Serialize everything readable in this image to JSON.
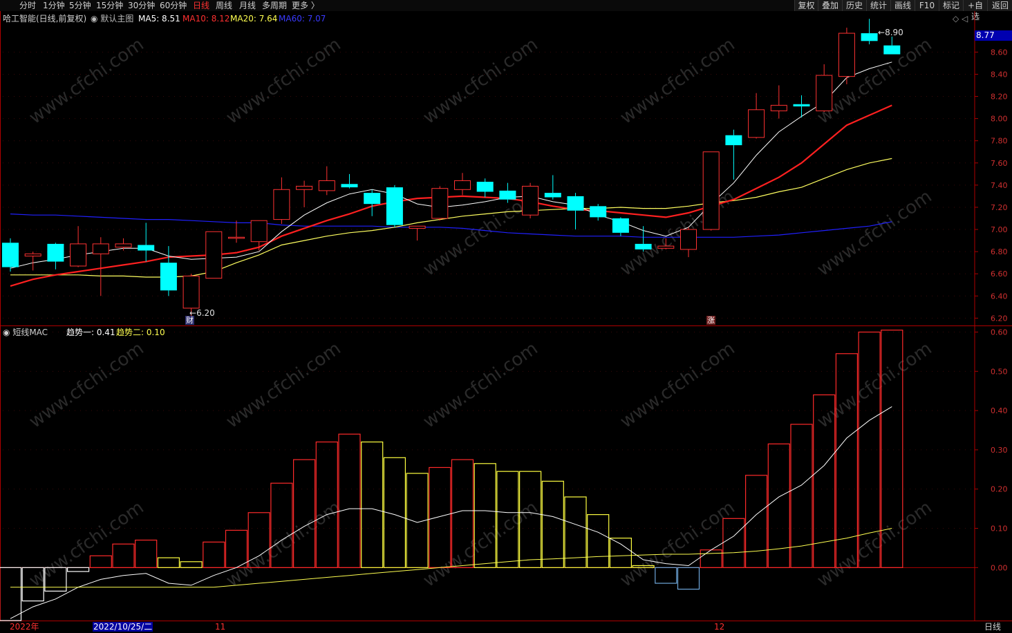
{
  "toolbar": {
    "periods": [
      "分时",
      "1分钟",
      "5分钟",
      "15分钟",
      "30分钟",
      "60分钟",
      "日线",
      "周线",
      "月线",
      "多周期",
      "更多 〉"
    ],
    "active_period": "日线",
    "right_buttons": [
      "复权",
      "叠加",
      "历史",
      "统计",
      "画线",
      "F10",
      "标记",
      "+自选",
      "返回"
    ]
  },
  "header": {
    "stock": "哈工智能(日线,前复权)",
    "template": "默认主图",
    "ma5": "MA5: 8.51",
    "ma10": "MA10: 8.12",
    "ma20": "MA20: 7.64",
    "ma60": "MA60: 7.07",
    "right_icons": "◇ ◁"
  },
  "indicator": {
    "name": "短线MAC",
    "trend1": "趋势一: 0.41",
    "trend2": "趋势二: 0.10"
  },
  "markers": {
    "high_label": "8.90",
    "low_label": "6.20",
    "badge_cai": "财",
    "badge_zhang": "涨",
    "current_price": "8.77"
  },
  "price_axis": [
    "8.60",
    "8.40",
    "8.20",
    "8.00",
    "7.80",
    "7.60",
    "7.40",
    "7.20",
    "7.00",
    "6.80",
    "6.60",
    "6.40",
    "6.20"
  ],
  "indicator_axis": [
    "0.60",
    "0.50",
    "0.40",
    "0.30",
    "0.20",
    "0.10",
    "0.00"
  ],
  "date_axis": {
    "year": "2022年",
    "cursor_date": "2022/10/25/二",
    "month11": "11",
    "month12": "12",
    "period_tag": "日线"
  },
  "colors": {
    "up": "#ff3232",
    "down": "#00ffff",
    "ma5": "#ffffff",
    "ma10": "#ff2020",
    "ma20": "#ffff60",
    "ma60": "#2020ff",
    "bar_red": "#ff2a2a",
    "bar_yellow": "#ffff40",
    "bar_blue": "#6fa8dc",
    "bar_white": "#ffffff",
    "axis": "#b00000",
    "watermark": "#2a2a2a"
  },
  "chart_data": [
    {
      "type": "candlestick",
      "title": "哈工智能(日线,前复权)",
      "ylim": [
        6.14,
        8.97
      ],
      "candles": [
        {
          "o": 6.88,
          "h": 6.92,
          "l": 6.62,
          "c": 6.66
        },
        {
          "o": 6.76,
          "h": 6.8,
          "l": 6.63,
          "c": 6.78
        },
        {
          "o": 6.87,
          "h": 6.88,
          "l": 6.64,
          "c": 6.71
        },
        {
          "o": 6.67,
          "h": 7.03,
          "l": 6.66,
          "c": 6.87
        },
        {
          "o": 6.78,
          "h": 6.93,
          "l": 6.4,
          "c": 6.87
        },
        {
          "o": 6.84,
          "h": 6.92,
          "l": 6.81,
          "c": 6.87
        },
        {
          "o": 6.86,
          "h": 7.06,
          "l": 6.71,
          "c": 6.81
        },
        {
          "o": 6.7,
          "h": 6.85,
          "l": 6.4,
          "c": 6.45
        },
        {
          "o": 6.29,
          "h": 6.6,
          "l": 6.2,
          "c": 6.58
        },
        {
          "o": 6.56,
          "h": 6.98,
          "l": 6.56,
          "c": 6.98
        },
        {
          "o": 6.92,
          "h": 7.08,
          "l": 6.88,
          "c": 6.93
        },
        {
          "o": 6.89,
          "h": 7.08,
          "l": 6.81,
          "c": 7.08
        },
        {
          "o": 7.09,
          "h": 7.47,
          "l": 7.05,
          "c": 7.36
        },
        {
          "o": 7.36,
          "h": 7.44,
          "l": 7.2,
          "c": 7.39
        },
        {
          "o": 7.35,
          "h": 7.57,
          "l": 7.31,
          "c": 7.44
        },
        {
          "o": 7.41,
          "h": 7.5,
          "l": 7.37,
          "c": 7.38
        },
        {
          "o": 7.33,
          "h": 7.36,
          "l": 7.12,
          "c": 7.23
        },
        {
          "o": 7.38,
          "h": 7.4,
          "l": 7.02,
          "c": 7.04
        },
        {
          "o": 7.01,
          "h": 7.03,
          "l": 6.9,
          "c": 7.03
        },
        {
          "o": 7.1,
          "h": 7.39,
          "l": 7.08,
          "c": 7.37
        },
        {
          "o": 7.36,
          "h": 7.51,
          "l": 7.31,
          "c": 7.44
        },
        {
          "o": 7.43,
          "h": 7.46,
          "l": 7.29,
          "c": 7.34
        },
        {
          "o": 7.35,
          "h": 7.42,
          "l": 7.24,
          "c": 7.27
        },
        {
          "o": 7.13,
          "h": 7.42,
          "l": 7.1,
          "c": 7.39
        },
        {
          "o": 7.33,
          "h": 7.49,
          "l": 7.27,
          "c": 7.29
        },
        {
          "o": 7.3,
          "h": 7.33,
          "l": 7.0,
          "c": 7.17
        },
        {
          "o": 7.21,
          "h": 7.23,
          "l": 7.08,
          "c": 7.11
        },
        {
          "o": 7.1,
          "h": 7.11,
          "l": 6.94,
          "c": 6.97
        },
        {
          "o": 6.87,
          "h": 7.03,
          "l": 6.8,
          "c": 6.82
        },
        {
          "o": 6.83,
          "h": 6.92,
          "l": 6.82,
          "c": 6.85
        },
        {
          "o": 6.82,
          "h": 7.02,
          "l": 6.75,
          "c": 7.0
        },
        {
          "o": 7.0,
          "h": 7.7,
          "l": 6.99,
          "c": 7.7
        },
        {
          "o": 7.85,
          "h": 7.9,
          "l": 7.45,
          "c": 7.76
        },
        {
          "o": 7.83,
          "h": 8.23,
          "l": 7.82,
          "c": 8.08
        },
        {
          "o": 8.07,
          "h": 8.3,
          "l": 8.0,
          "c": 8.12
        },
        {
          "o": 8.13,
          "h": 8.21,
          "l": 8.01,
          "c": 8.11
        },
        {
          "o": 8.07,
          "h": 8.49,
          "l": 8.06,
          "c": 8.39
        },
        {
          "o": 8.38,
          "h": 8.82,
          "l": 8.31,
          "c": 8.77
        },
        {
          "o": 8.77,
          "h": 8.9,
          "l": 8.67,
          "c": 8.7
        },
        {
          "o": 8.66,
          "h": 8.74,
          "l": 8.58,
          "c": 8.58
        }
      ],
      "ma5": [
        6.65,
        6.7,
        6.73,
        6.77,
        6.8,
        6.83,
        6.83,
        6.76,
        6.73,
        6.74,
        6.75,
        6.8,
        6.98,
        7.13,
        7.24,
        7.32,
        7.36,
        7.32,
        7.23,
        7.2,
        7.22,
        7.25,
        7.29,
        7.3,
        7.25,
        7.22,
        7.13,
        7.07,
        6.99,
        6.94,
        7.02,
        7.23,
        7.42,
        7.67,
        7.88,
        8.02,
        8.15,
        8.37,
        8.45,
        8.51
      ],
      "ma10": [
        6.49,
        6.55,
        6.59,
        6.62,
        6.65,
        6.68,
        6.71,
        6.75,
        6.76,
        6.77,
        6.79,
        6.84,
        6.94,
        7.01,
        7.08,
        7.14,
        7.21,
        7.25,
        7.28,
        7.29,
        7.3,
        7.29,
        7.28,
        7.25,
        7.21,
        7.18,
        7.17,
        7.15,
        7.13,
        7.11,
        7.15,
        7.21,
        7.27,
        7.37,
        7.47,
        7.6,
        7.77,
        7.94,
        8.03,
        8.12
      ],
      "ma20": [
        6.59,
        6.59,
        6.59,
        6.59,
        6.58,
        6.58,
        6.57,
        6.57,
        6.58,
        6.62,
        6.7,
        6.77,
        6.86,
        6.9,
        6.94,
        6.97,
        6.99,
        7.02,
        7.06,
        7.09,
        7.12,
        7.14,
        7.16,
        7.17,
        7.18,
        7.19,
        7.19,
        7.2,
        7.19,
        7.19,
        7.21,
        7.24,
        7.26,
        7.29,
        7.34,
        7.38,
        7.46,
        7.54,
        7.6,
        7.64
      ],
      "ma60": [
        7.14,
        7.13,
        7.13,
        7.12,
        7.11,
        7.1,
        7.09,
        7.09,
        7.08,
        7.07,
        7.06,
        7.06,
        7.04,
        7.03,
        7.03,
        7.03,
        7.03,
        7.02,
        7.02,
        7.02,
        7.01,
        6.99,
        6.97,
        6.96,
        6.95,
        6.94,
        6.94,
        6.94,
        6.93,
        6.93,
        6.93,
        6.93,
        6.93,
        6.94,
        6.95,
        6.97,
        6.99,
        7.01,
        7.03,
        7.07
      ]
    },
    {
      "type": "bar",
      "title": "短线MAC",
      "ylim": [
        -0.135,
        0.615
      ],
      "bars": [
        -0.135,
        -0.085,
        -0.06,
        -0.01,
        0.03,
        0.06,
        0.07,
        0.025,
        0.015,
        0.065,
        0.095,
        0.14,
        0.215,
        0.275,
        0.32,
        0.34,
        0.32,
        0.28,
        0.24,
        0.255,
        0.275,
        0.265,
        0.245,
        0.245,
        0.22,
        0.18,
        0.135,
        0.075,
        0.005,
        -0.04,
        -0.055,
        0.045,
        0.125,
        0.235,
        0.315,
        0.365,
        0.44,
        0.545,
        0.6,
        0.605
      ],
      "bar_colors": [
        "white",
        "white",
        "white",
        "white",
        "red",
        "red",
        "red",
        "yellow",
        "yellow",
        "red",
        "red",
        "red",
        "red",
        "red",
        "red",
        "red",
        "yellow",
        "yellow",
        "yellow",
        "red",
        "red",
        "yellow",
        "yellow",
        "yellow",
        "yellow",
        "yellow",
        "yellow",
        "yellow",
        "yellow",
        "blue",
        "blue",
        "red",
        "red",
        "red",
        "red",
        "red",
        "red",
        "red",
        "red",
        "red"
      ],
      "trend1": [
        -0.13,
        -0.1,
        -0.08,
        -0.05,
        -0.03,
        -0.02,
        -0.015,
        -0.04,
        -0.045,
        -0.02,
        0.0,
        0.03,
        0.07,
        0.105,
        0.135,
        0.15,
        0.15,
        0.135,
        0.115,
        0.13,
        0.145,
        0.145,
        0.14,
        0.14,
        0.13,
        0.11,
        0.09,
        0.06,
        0.02,
        0.01,
        0.005,
        0.045,
        0.08,
        0.135,
        0.18,
        0.21,
        0.26,
        0.33,
        0.375,
        0.41
      ],
      "trend2": [
        -0.05,
        -0.05,
        -0.05,
        -0.05,
        -0.05,
        -0.05,
        -0.05,
        -0.05,
        -0.05,
        -0.05,
        -0.045,
        -0.04,
        -0.035,
        -0.03,
        -0.025,
        -0.02,
        -0.015,
        -0.01,
        -0.005,
        0.0,
        0.005,
        0.01,
        0.015,
        0.02,
        0.022,
        0.025,
        0.028,
        0.03,
        0.032,
        0.034,
        0.034,
        0.036,
        0.038,
        0.042,
        0.048,
        0.055,
        0.065,
        0.075,
        0.088,
        0.1
      ]
    }
  ]
}
